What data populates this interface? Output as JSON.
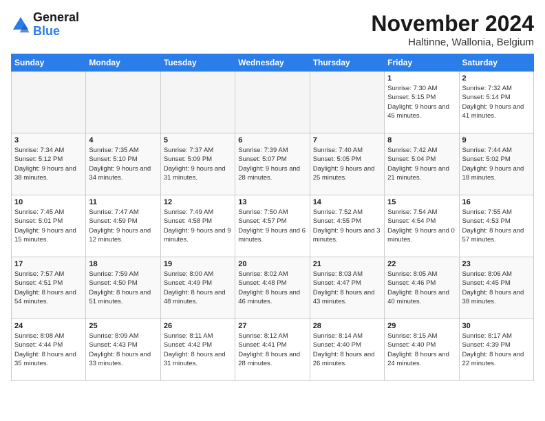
{
  "logo": {
    "text_general": "General",
    "text_blue": "Blue"
  },
  "title": "November 2024",
  "location": "Haltinne, Wallonia, Belgium",
  "weekdays": [
    "Sunday",
    "Monday",
    "Tuesday",
    "Wednesday",
    "Thursday",
    "Friday",
    "Saturday"
  ],
  "weeks": [
    [
      {
        "day": "",
        "info": ""
      },
      {
        "day": "",
        "info": ""
      },
      {
        "day": "",
        "info": ""
      },
      {
        "day": "",
        "info": ""
      },
      {
        "day": "",
        "info": ""
      },
      {
        "day": "1",
        "info": "Sunrise: 7:30 AM\nSunset: 5:15 PM\nDaylight: 9 hours and 45 minutes."
      },
      {
        "day": "2",
        "info": "Sunrise: 7:32 AM\nSunset: 5:14 PM\nDaylight: 9 hours and 41 minutes."
      }
    ],
    [
      {
        "day": "3",
        "info": "Sunrise: 7:34 AM\nSunset: 5:12 PM\nDaylight: 9 hours and 38 minutes."
      },
      {
        "day": "4",
        "info": "Sunrise: 7:35 AM\nSunset: 5:10 PM\nDaylight: 9 hours and 34 minutes."
      },
      {
        "day": "5",
        "info": "Sunrise: 7:37 AM\nSunset: 5:09 PM\nDaylight: 9 hours and 31 minutes."
      },
      {
        "day": "6",
        "info": "Sunrise: 7:39 AM\nSunset: 5:07 PM\nDaylight: 9 hours and 28 minutes."
      },
      {
        "day": "7",
        "info": "Sunrise: 7:40 AM\nSunset: 5:05 PM\nDaylight: 9 hours and 25 minutes."
      },
      {
        "day": "8",
        "info": "Sunrise: 7:42 AM\nSunset: 5:04 PM\nDaylight: 9 hours and 21 minutes."
      },
      {
        "day": "9",
        "info": "Sunrise: 7:44 AM\nSunset: 5:02 PM\nDaylight: 9 hours and 18 minutes."
      }
    ],
    [
      {
        "day": "10",
        "info": "Sunrise: 7:45 AM\nSunset: 5:01 PM\nDaylight: 9 hours and 15 minutes."
      },
      {
        "day": "11",
        "info": "Sunrise: 7:47 AM\nSunset: 4:59 PM\nDaylight: 9 hours and 12 minutes."
      },
      {
        "day": "12",
        "info": "Sunrise: 7:49 AM\nSunset: 4:58 PM\nDaylight: 9 hours and 9 minutes."
      },
      {
        "day": "13",
        "info": "Sunrise: 7:50 AM\nSunset: 4:57 PM\nDaylight: 9 hours and 6 minutes."
      },
      {
        "day": "14",
        "info": "Sunrise: 7:52 AM\nSunset: 4:55 PM\nDaylight: 9 hours and 3 minutes."
      },
      {
        "day": "15",
        "info": "Sunrise: 7:54 AM\nSunset: 4:54 PM\nDaylight: 9 hours and 0 minutes."
      },
      {
        "day": "16",
        "info": "Sunrise: 7:55 AM\nSunset: 4:53 PM\nDaylight: 8 hours and 57 minutes."
      }
    ],
    [
      {
        "day": "17",
        "info": "Sunrise: 7:57 AM\nSunset: 4:51 PM\nDaylight: 8 hours and 54 minutes."
      },
      {
        "day": "18",
        "info": "Sunrise: 7:59 AM\nSunset: 4:50 PM\nDaylight: 8 hours and 51 minutes."
      },
      {
        "day": "19",
        "info": "Sunrise: 8:00 AM\nSunset: 4:49 PM\nDaylight: 8 hours and 48 minutes."
      },
      {
        "day": "20",
        "info": "Sunrise: 8:02 AM\nSunset: 4:48 PM\nDaylight: 8 hours and 46 minutes."
      },
      {
        "day": "21",
        "info": "Sunrise: 8:03 AM\nSunset: 4:47 PM\nDaylight: 8 hours and 43 minutes."
      },
      {
        "day": "22",
        "info": "Sunrise: 8:05 AM\nSunset: 4:46 PM\nDaylight: 8 hours and 40 minutes."
      },
      {
        "day": "23",
        "info": "Sunrise: 8:06 AM\nSunset: 4:45 PM\nDaylight: 8 hours and 38 minutes."
      }
    ],
    [
      {
        "day": "24",
        "info": "Sunrise: 8:08 AM\nSunset: 4:44 PM\nDaylight: 8 hours and 35 minutes."
      },
      {
        "day": "25",
        "info": "Sunrise: 8:09 AM\nSunset: 4:43 PM\nDaylight: 8 hours and 33 minutes."
      },
      {
        "day": "26",
        "info": "Sunrise: 8:11 AM\nSunset: 4:42 PM\nDaylight: 8 hours and 31 minutes."
      },
      {
        "day": "27",
        "info": "Sunrise: 8:12 AM\nSunset: 4:41 PM\nDaylight: 8 hours and 28 minutes."
      },
      {
        "day": "28",
        "info": "Sunrise: 8:14 AM\nSunset: 4:40 PM\nDaylight: 8 hours and 26 minutes."
      },
      {
        "day": "29",
        "info": "Sunrise: 8:15 AM\nSunset: 4:40 PM\nDaylight: 8 hours and 24 minutes."
      },
      {
        "day": "30",
        "info": "Sunrise: 8:17 AM\nSunset: 4:39 PM\nDaylight: 8 hours and 22 minutes."
      }
    ]
  ]
}
